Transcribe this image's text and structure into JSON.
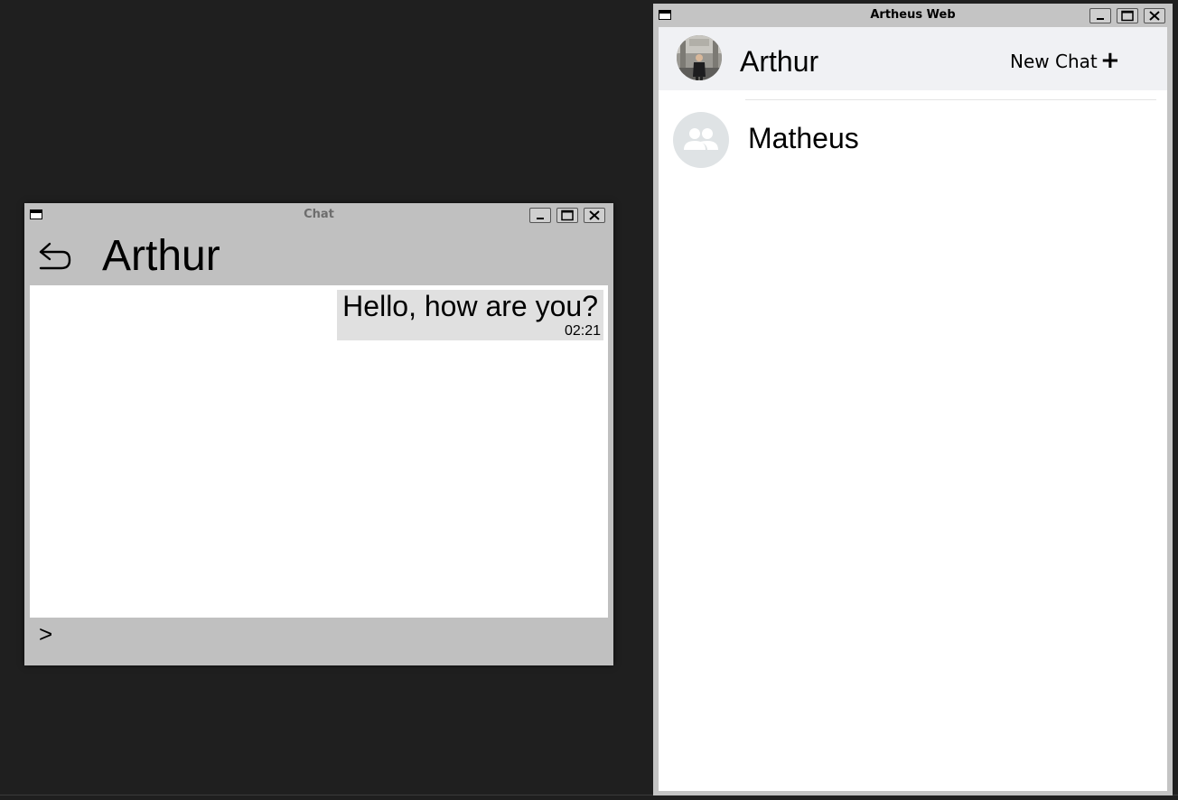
{
  "chat_window": {
    "title": "Chat",
    "header": {
      "contact_name": "Arthur"
    },
    "messages": [
      {
        "text": "Hello, how are you?",
        "time": "02:21"
      }
    ],
    "input": {
      "prompt": ">",
      "value": ""
    }
  },
  "web_window": {
    "title": "Artheus Web",
    "header": {
      "user_name": "Arthur",
      "new_chat_label": "New Chat"
    },
    "contacts": [
      {
        "name": "Matheus"
      }
    ]
  },
  "icons": {
    "back": "back-arrow-icon",
    "new_chat": "plus-icon",
    "group_avatar": "group-icon",
    "window_menu": "window-menu-icon",
    "minimize": "minimize-icon",
    "maximize": "maximize-icon",
    "close": "close-icon"
  },
  "colors": {
    "desktop": "#1f1f1f",
    "chat_chrome": "#c0c0c0",
    "bubble": "#e0e0e0",
    "web_header": "#f0f1f4",
    "group_avatar_bg": "#dfe3e5"
  }
}
